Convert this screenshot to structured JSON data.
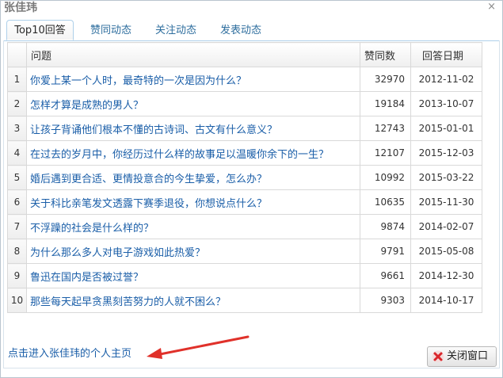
{
  "dialog": {
    "title": "张佳玮",
    "close_glyph": "×"
  },
  "tabs": [
    {
      "label": "Top10回答",
      "active": true
    },
    {
      "label": "赞同动态",
      "active": false
    },
    {
      "label": "关注动态",
      "active": false
    },
    {
      "label": "发表动态",
      "active": false
    }
  ],
  "table": {
    "headers": {
      "index": "",
      "question": "问题",
      "votes": "赞同数",
      "date": "回答日期"
    },
    "rows": [
      {
        "index": "1",
        "question": "你爱上某一个人时，最奇特的一次是因为什么？",
        "votes": "32970",
        "date": "2012-11-02"
      },
      {
        "index": "2",
        "question": "怎样才算是成熟的男人？",
        "votes": "19184",
        "date": "2013-10-07"
      },
      {
        "index": "3",
        "question": "让孩子背诵他们根本不懂的古诗词、古文有什么意义？",
        "votes": "12743",
        "date": "2015-01-01"
      },
      {
        "index": "4",
        "question": "在过去的岁月中，你经历过什么样的故事足以温暖你余下的一生？",
        "votes": "12107",
        "date": "2015-12-03"
      },
      {
        "index": "5",
        "question": "婚后遇到更合适、更情投意合的今生挚爱，怎么办？",
        "votes": "10992",
        "date": "2015-03-22"
      },
      {
        "index": "6",
        "question": "关于科比亲笔发文透露下赛季退役，你想说点什么？",
        "votes": "10635",
        "date": "2015-11-30"
      },
      {
        "index": "7",
        "question": "不浮躁的社会是什么样的？",
        "votes": "9874",
        "date": "2014-02-07"
      },
      {
        "index": "8",
        "question": "为什么那么多人对电子游戏如此热爱？",
        "votes": "9791",
        "date": "2015-05-08"
      },
      {
        "index": "9",
        "question": "鲁迅在国内是否被过誉？",
        "votes": "9661",
        "date": "2014-12-30"
      },
      {
        "index": "10",
        "question": "那些每天起早贪黑刻苦努力的人就不困么？",
        "votes": "9303",
        "date": "2014-10-17"
      }
    ]
  },
  "footer": {
    "profile_link": "点击进入张佳玮的个人主页",
    "close_button": "关闭窗口"
  },
  "colors": {
    "link": "#1a5ea8",
    "annotation_arrow": "#e0312a",
    "close_icon": "#d9262b"
  },
  "icons": {
    "close_button_icon": "red-x-icon",
    "annotation": "red-arrow-icon"
  }
}
